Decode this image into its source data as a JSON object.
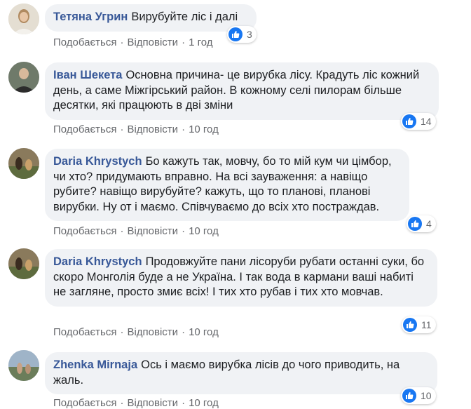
{
  "colors": {
    "accent": "#385898",
    "like_blue": "#1877f2",
    "bubble_bg": "#f0f2f5",
    "meta_text": "#65676b"
  },
  "comments": [
    {
      "author": "Тетяна Угрин",
      "text": "Вирубуйте ліс і далі",
      "like": "Подобається",
      "reply": "Відповісти",
      "time": "1 год",
      "reactions": "3",
      "reaction_icon": "like-icon"
    },
    {
      "author": "Іван Шекета",
      "text": "Основна причина- це вирубка лісу. Крадуть ліс кожний день, а саме Міжгірський район. В кожному селі пилорам більше десятки, які працюють в дві зміни",
      "like": "Подобається",
      "reply": "Відповісти",
      "time": "10 год",
      "reactions": "14",
      "reaction_icon": "like-icon"
    },
    {
      "author": "Daria Khrystych",
      "text": "Бо кажуть так, мовчу, бо то мій кум чи цімбор, чи хто? придумають вправно. На всі зауваження: а навіщо рубите? навіщо вирубуйте? кажуть, що то планові, планові вирубки. Ну от і маємо. Співчуваємо до всіх хто постраждав.",
      "like": "Подобається",
      "reply": "Відповісти",
      "time": "10 год",
      "reactions": "4",
      "reaction_icon": "like-icon"
    },
    {
      "author": "Daria Khrystych",
      "text": "Продовжуйте пани лісоруби рубати останні суки, бо скоро Монголія буде а не Україна. І так вода в кармани ваші набиті не загляне, просто змиє всіх! І тих хто рубав і тих хто мовчав.",
      "like": "Подобається",
      "reply": "Відповісти",
      "time": "10 год",
      "reactions": "11",
      "reaction_icon": "like-icon"
    },
    {
      "author": "Zhenka Mirnaja",
      "text": "Ось і маємо вирубка лісів до чого приводить, на жаль.",
      "like": "Подобається",
      "reply": "Відповісти",
      "time": "10 год",
      "reactions": "10",
      "reaction_icon": "like-icon"
    }
  ]
}
